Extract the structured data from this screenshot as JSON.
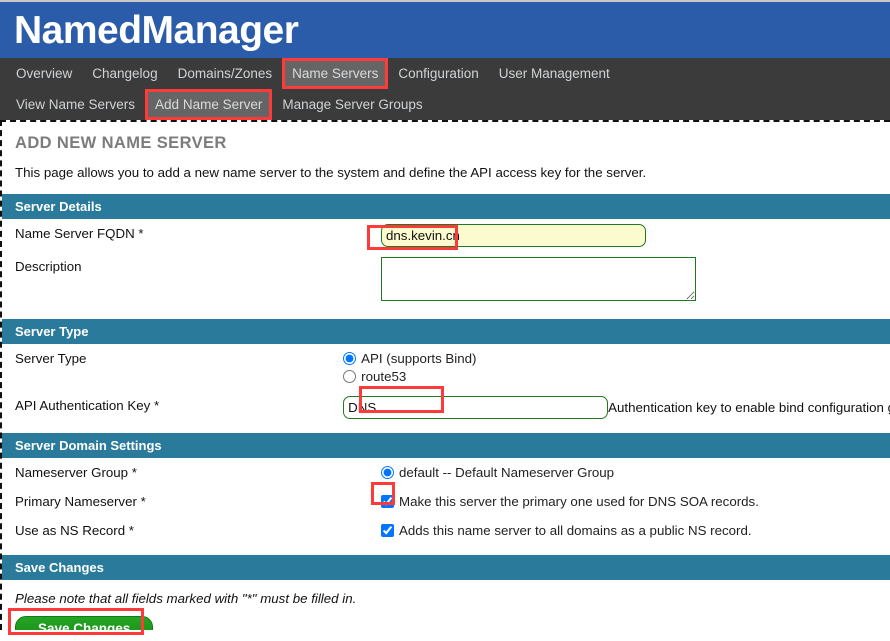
{
  "header": {
    "title": "NamedManager",
    "brand_color": "#2a5caa"
  },
  "nav": {
    "primary": [
      {
        "label": "Overview",
        "active": false
      },
      {
        "label": "Changelog",
        "active": false
      },
      {
        "label": "Domains/Zones",
        "active": false
      },
      {
        "label": "Name Servers",
        "active": true,
        "highlighted": true
      },
      {
        "label": "Configuration",
        "active": false
      },
      {
        "label": "User Management",
        "active": false
      }
    ],
    "secondary": [
      {
        "label": "View Name Servers",
        "active": false
      },
      {
        "label": "Add Name Server",
        "active": true,
        "highlighted": true
      },
      {
        "label": "Manage Server Groups",
        "active": false
      }
    ]
  },
  "page": {
    "title": "ADD NEW NAME SERVER",
    "description": "This page allows you to add a new name server to the system and define the API access key for the server."
  },
  "sections": {
    "server_details": {
      "heading": "Server Details",
      "fqdn_label": "Name Server FQDN *",
      "fqdn_value": "dns.kevin.cn",
      "fqdn_placeholder": "",
      "description_label": "Description",
      "description_value": "",
      "description_placeholder": ""
    },
    "server_type": {
      "heading": "Server Type",
      "type_label": "Server Type",
      "options": [
        {
          "label": "API (supports Bind)",
          "selected": true
        },
        {
          "label": "route53",
          "selected": false
        }
      ],
      "auth_key_label": "API Authentication Key *",
      "auth_key_value": "DNS",
      "auth_key_help": "Authentication key to enable bind configuration g"
    },
    "server_domain_settings": {
      "heading": "Server Domain Settings",
      "group_label": "Nameserver Group *",
      "group_options": [
        {
          "label": "default -- Default Nameserver Group",
          "selected": true
        }
      ],
      "primary_label": "Primary Nameserver *",
      "primary_checkbox_label": "Make this server the primary one used for DNS SOA records.",
      "primary_checked": true,
      "ns_record_label": "Use as NS Record *",
      "ns_record_checkbox_label": "Adds this name server to all domains as a public NS record.",
      "ns_record_checked": true
    },
    "save_changes": {
      "heading": "Save Changes",
      "note": "Please note that all fields marked with \"*\" must be filled in.",
      "button_label": "Save Changes"
    }
  },
  "annotations": {
    "highlight_color": "#fd3b3b"
  }
}
